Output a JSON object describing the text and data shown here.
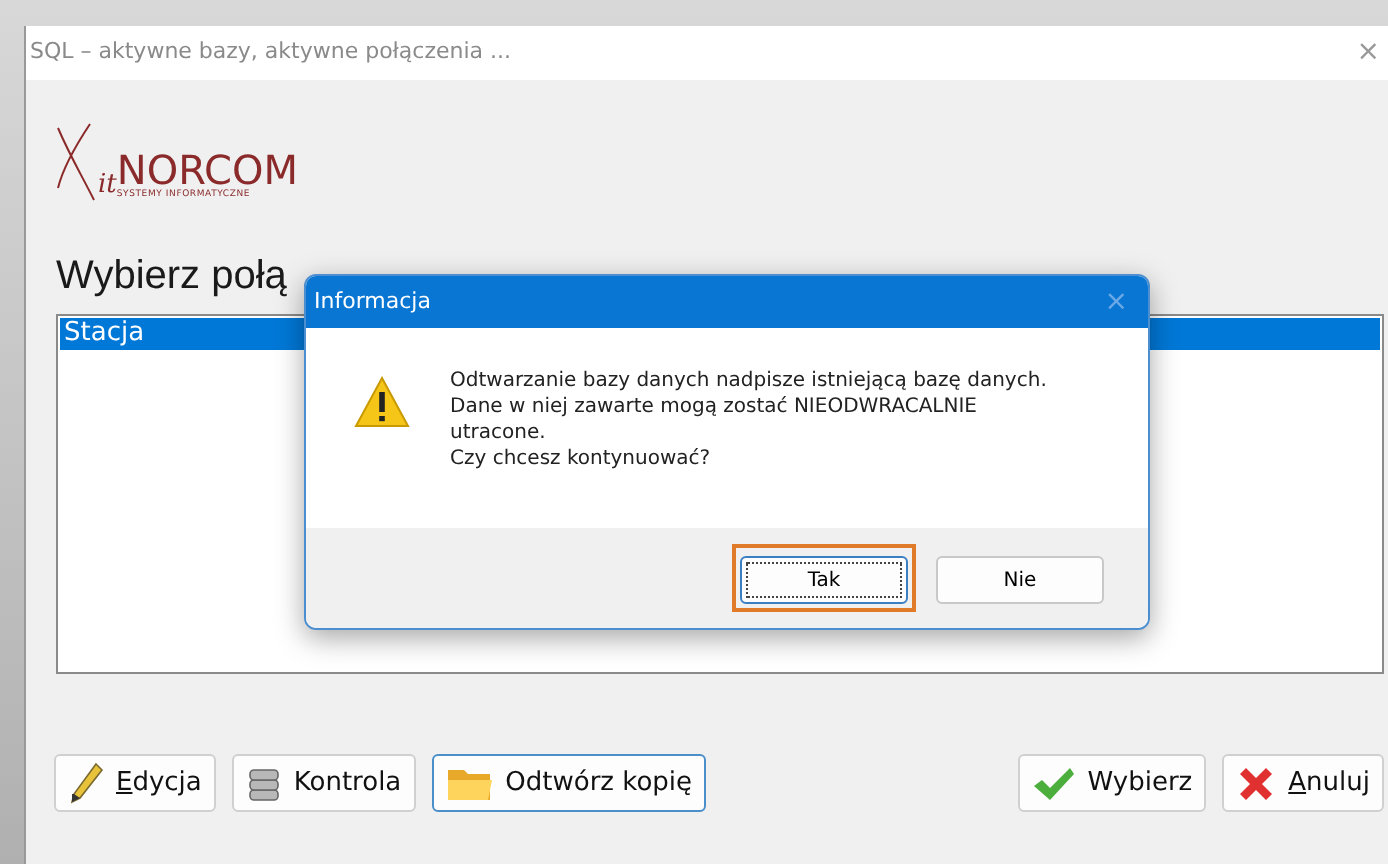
{
  "window": {
    "title": "SQL – aktywne bazy, aktywne połączenia ...",
    "close": "×"
  },
  "logo": {
    "prefix": "it",
    "name": "NORCOM",
    "tagline": "SYSTEMY INFORMATYCZNE"
  },
  "heading": "Wybierz połą",
  "connections": [
    {
      "label": "Stacja",
      "selected": true
    }
  ],
  "buttons": [
    {
      "label": "Edycja",
      "kind": "pencil",
      "underline_first": true,
      "focused": false
    },
    {
      "label": "Kontrola",
      "kind": "database",
      "underline_first": false,
      "focused": false
    },
    {
      "label": "Odtwórz kopię",
      "kind": "folder",
      "underline_first": false,
      "focused": true
    },
    {
      "label": "Wybierz",
      "kind": "check",
      "underline_first": false,
      "focused": false
    },
    {
      "label": "Anuluj",
      "kind": "cross",
      "underline_first": true,
      "focused": false
    }
  ],
  "dialog": {
    "title": "Informacja",
    "close": "×",
    "message_lines": [
      "Odtwarzanie bazy danych nadpisze istniejącą bazę danych.",
      "Dane w niej zawarte mogą zostać NIEODWRACALNIE",
      "utracone.",
      "Czy chcesz kontynuować?"
    ],
    "buttons": [
      {
        "label": "Tak",
        "highlighted": true
      },
      {
        "label": "Nie",
        "highlighted": false
      }
    ]
  }
}
